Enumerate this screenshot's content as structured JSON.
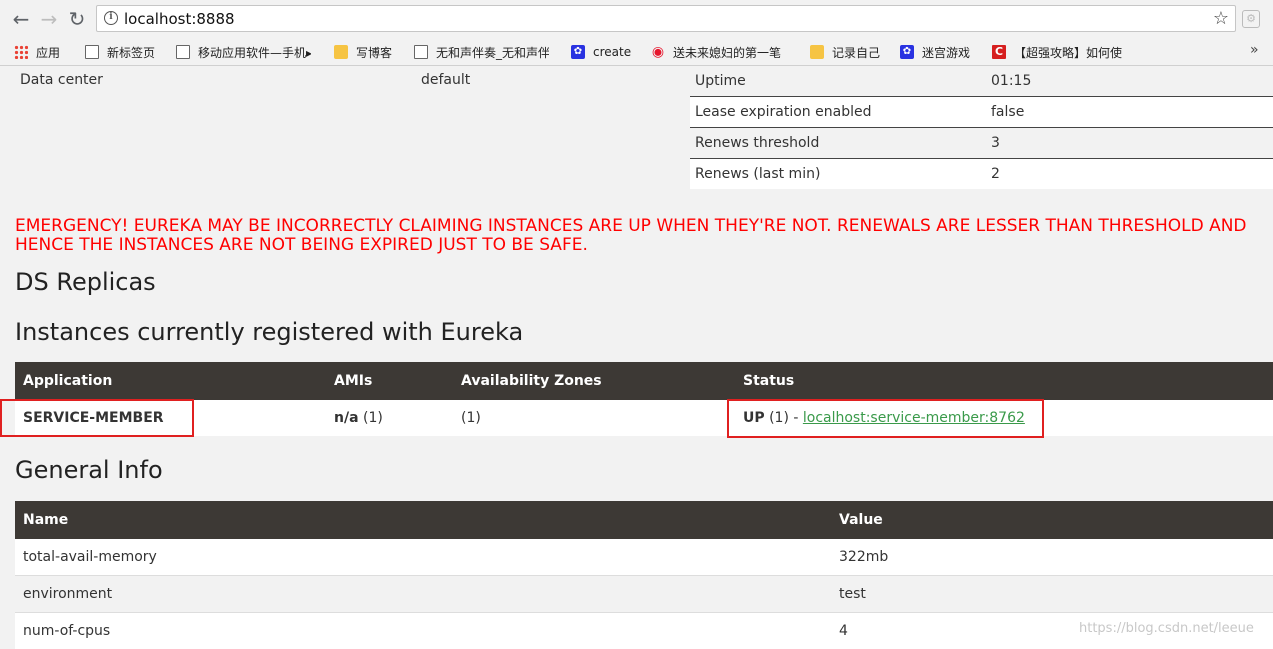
{
  "browser": {
    "url": "localhost:8888",
    "bookmarks": [
      {
        "label": "应用",
        "icon": "apps-icon"
      },
      {
        "label": "新标签页",
        "icon": "page-icon"
      },
      {
        "label": "移动应用软件—手机▸",
        "icon": "page-icon"
      },
      {
        "label": "写博客",
        "icon": "folder-icon"
      },
      {
        "label": "无和声伴奏_无和声伴",
        "icon": "page-icon"
      },
      {
        "label": "create",
        "icon": "paw-icon"
      },
      {
        "label": "送未来媳妇的第一笔",
        "icon": "weibo-icon"
      },
      {
        "label": "记录自己",
        "icon": "folder-icon"
      },
      {
        "label": "迷宫游戏",
        "icon": "paw-icon"
      },
      {
        "label": "【超强攻略】如何使",
        "icon": "c-icon"
      }
    ],
    "more": "»"
  },
  "env": {
    "left_label": "Data center",
    "left_value": "default",
    "rows": [
      {
        "name": "Uptime",
        "value": "01:15"
      },
      {
        "name": "Lease expiration enabled",
        "value": "false"
      },
      {
        "name": "Renews threshold",
        "value": "3"
      },
      {
        "name": "Renews (last min)",
        "value": "2"
      }
    ]
  },
  "emergency": {
    "line1": "EMERGENCY! EUREKA MAY BE INCORRECTLY CLAIMING INSTANCES ARE UP WHEN THEY'RE NOT. RENEWALS ARE LESSER THAN THRESHOLD AND",
    "line2": "HENCE THE INSTANCES ARE NOT BEING EXPIRED JUST TO BE SAFE."
  },
  "headings": {
    "replicas": "DS Replicas",
    "instances": "Instances currently registered with Eureka",
    "general": "General Info"
  },
  "instances": {
    "columns": [
      "Application",
      "AMIs",
      "Availability Zones",
      "Status"
    ],
    "rows": [
      {
        "application": "SERVICE-MEMBER",
        "amis_bold": "n/a",
        "amis_count": " (1)",
        "zones": "(1)",
        "status_bold": "UP",
        "status_count": " (1) - ",
        "status_link": "localhost:service-member:8762"
      }
    ]
  },
  "general": {
    "columns": [
      "Name",
      "Value"
    ],
    "rows": [
      {
        "name": "total-avail-memory",
        "value": "322mb"
      },
      {
        "name": "environment",
        "value": "test"
      },
      {
        "name": "num-of-cpus",
        "value": "4"
      }
    ]
  },
  "watermark": "https://blog.csdn.net/leeue",
  "colors": {
    "header_bg": "#3d3935",
    "emergency": "#ff0000",
    "link": "#3a9a4a",
    "highlight_box": "#e02020"
  }
}
